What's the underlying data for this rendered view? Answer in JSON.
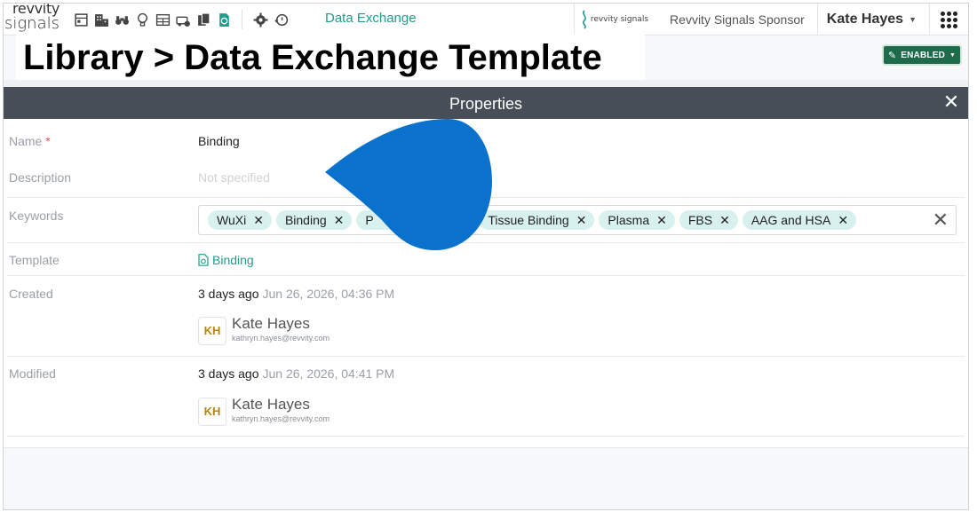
{
  "brand": {
    "logo_line1": "revvity",
    "logo_line2": "signals"
  },
  "toolbar": {
    "icons": [
      "notebook-icon",
      "building-icon",
      "binoculars-icon",
      "lightbulb-icon",
      "table-icon",
      "vehicle-settings-icon",
      "clipboard-icon",
      "document-refresh-icon",
      "gear-icon",
      "recent-activity-icon"
    ],
    "app_name": "Data Exchange"
  },
  "header_right": {
    "partner_logo_text": "revvity signals",
    "sponsor": "Revvity Signals Sponsor",
    "user_name": "Kate Hayes",
    "apps_icon": "apps-grid-icon"
  },
  "page": {
    "title": "Library > Data Exchange Template",
    "status_button": "ENABLED"
  },
  "properties": {
    "header": "Properties",
    "close_icon": "close-icon",
    "name_label": "Name",
    "required_mark": "*",
    "name_value": "Binding",
    "description_label": "Description",
    "description_placeholder": "Not specified",
    "keywords_label": "Keywords",
    "keywords": [
      {
        "label": "WuXi"
      },
      {
        "label": "Binding"
      },
      {
        "label": "P"
      },
      {
        "label": ""
      },
      {
        "label": "Tissue Binding"
      },
      {
        "label": "Plasma"
      },
      {
        "label": "FBS"
      },
      {
        "label": "AAG and HSA"
      }
    ],
    "template_label": "Template",
    "template_value": "Binding",
    "created_label": "Created",
    "created_relative": "3 days ago",
    "created_absolute": "Jun 26, 2026, 04:36 PM",
    "created_user": {
      "initials": "KH",
      "name": "Kate Hayes",
      "email": "kathryn.hayes@revvity.com"
    },
    "modified_label": "Modified",
    "modified_relative": "3 days ago",
    "modified_absolute": "Jun 26, 2026, 04:41 PM",
    "modified_user": {
      "initials": "KH",
      "name": "Kate Hayes",
      "email": "kathryn.hayes@revvity.com"
    }
  },
  "colors": {
    "accent": "#1e9d8c",
    "header_bg": "#474e57",
    "enabled_bg": "#1e6b4c",
    "chip_bg": "#d8f0ee",
    "cursor_blob": "#0a72cc"
  }
}
